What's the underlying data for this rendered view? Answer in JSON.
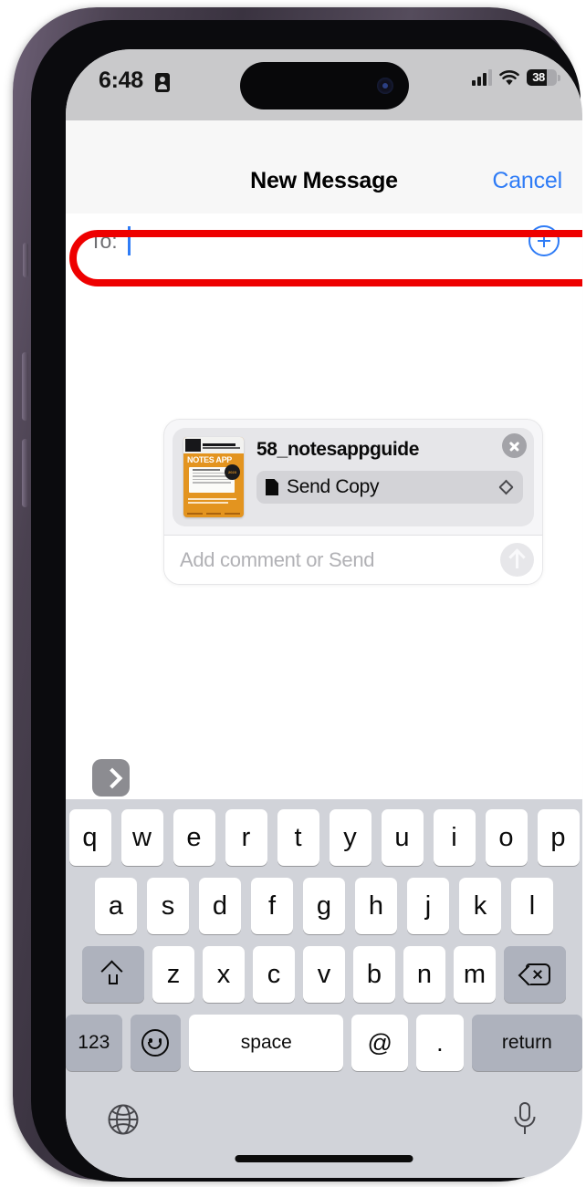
{
  "status_bar": {
    "time": "6:48",
    "focus_icon": "id-card-icon",
    "signal_icon": "cellular-signal-icon",
    "wifi_icon": "wifi-icon",
    "battery_percent": "38"
  },
  "nav": {
    "title": "New Message",
    "cancel_label": "Cancel"
  },
  "to_field": {
    "label": "To:",
    "value": "",
    "add_contact_icon": "add-contact-plus-icon"
  },
  "annotation": {
    "color": "#ee0000",
    "target": "to-field"
  },
  "attachment": {
    "filename": "58_notesappguide",
    "thumbnail_title": "NOTES APP",
    "thumbnail_header": "IN-DEPTH GUIDE",
    "thumbnail_badge": "2023",
    "send_mode_label": "Send Copy",
    "send_mode_icon": "document-icon",
    "send_mode_chevron": "chevron-up-down-icon",
    "close_icon": "close-x-icon",
    "comment_placeholder": "Add comment or Send",
    "send_icon": "arrow-up-send-icon",
    "expand_icon": "chevron-right-expand-icon"
  },
  "keyboard": {
    "row1": [
      "q",
      "w",
      "e",
      "r",
      "t",
      "y",
      "u",
      "i",
      "o",
      "p"
    ],
    "row2": [
      "a",
      "s",
      "d",
      "f",
      "g",
      "h",
      "j",
      "k",
      "l"
    ],
    "row3_letters": [
      "z",
      "x",
      "c",
      "v",
      "b",
      "n",
      "m"
    ],
    "shift_icon": "shift-arrow-icon",
    "delete_icon": "backspace-delete-icon",
    "numbers_label": "123",
    "emoji_icon": "emoji-smiley-icon",
    "space_label": "space",
    "at_label": "@",
    "period_label": ".",
    "return_label": "return",
    "globe_icon": "globe-language-icon",
    "mic_icon": "microphone-dictation-icon"
  },
  "colors": {
    "accent_blue": "#2f7cf6",
    "annotation_red": "#ee0000",
    "keyboard_bg": "#d1d3d9",
    "thumbnail_orange": "#e3941f"
  }
}
